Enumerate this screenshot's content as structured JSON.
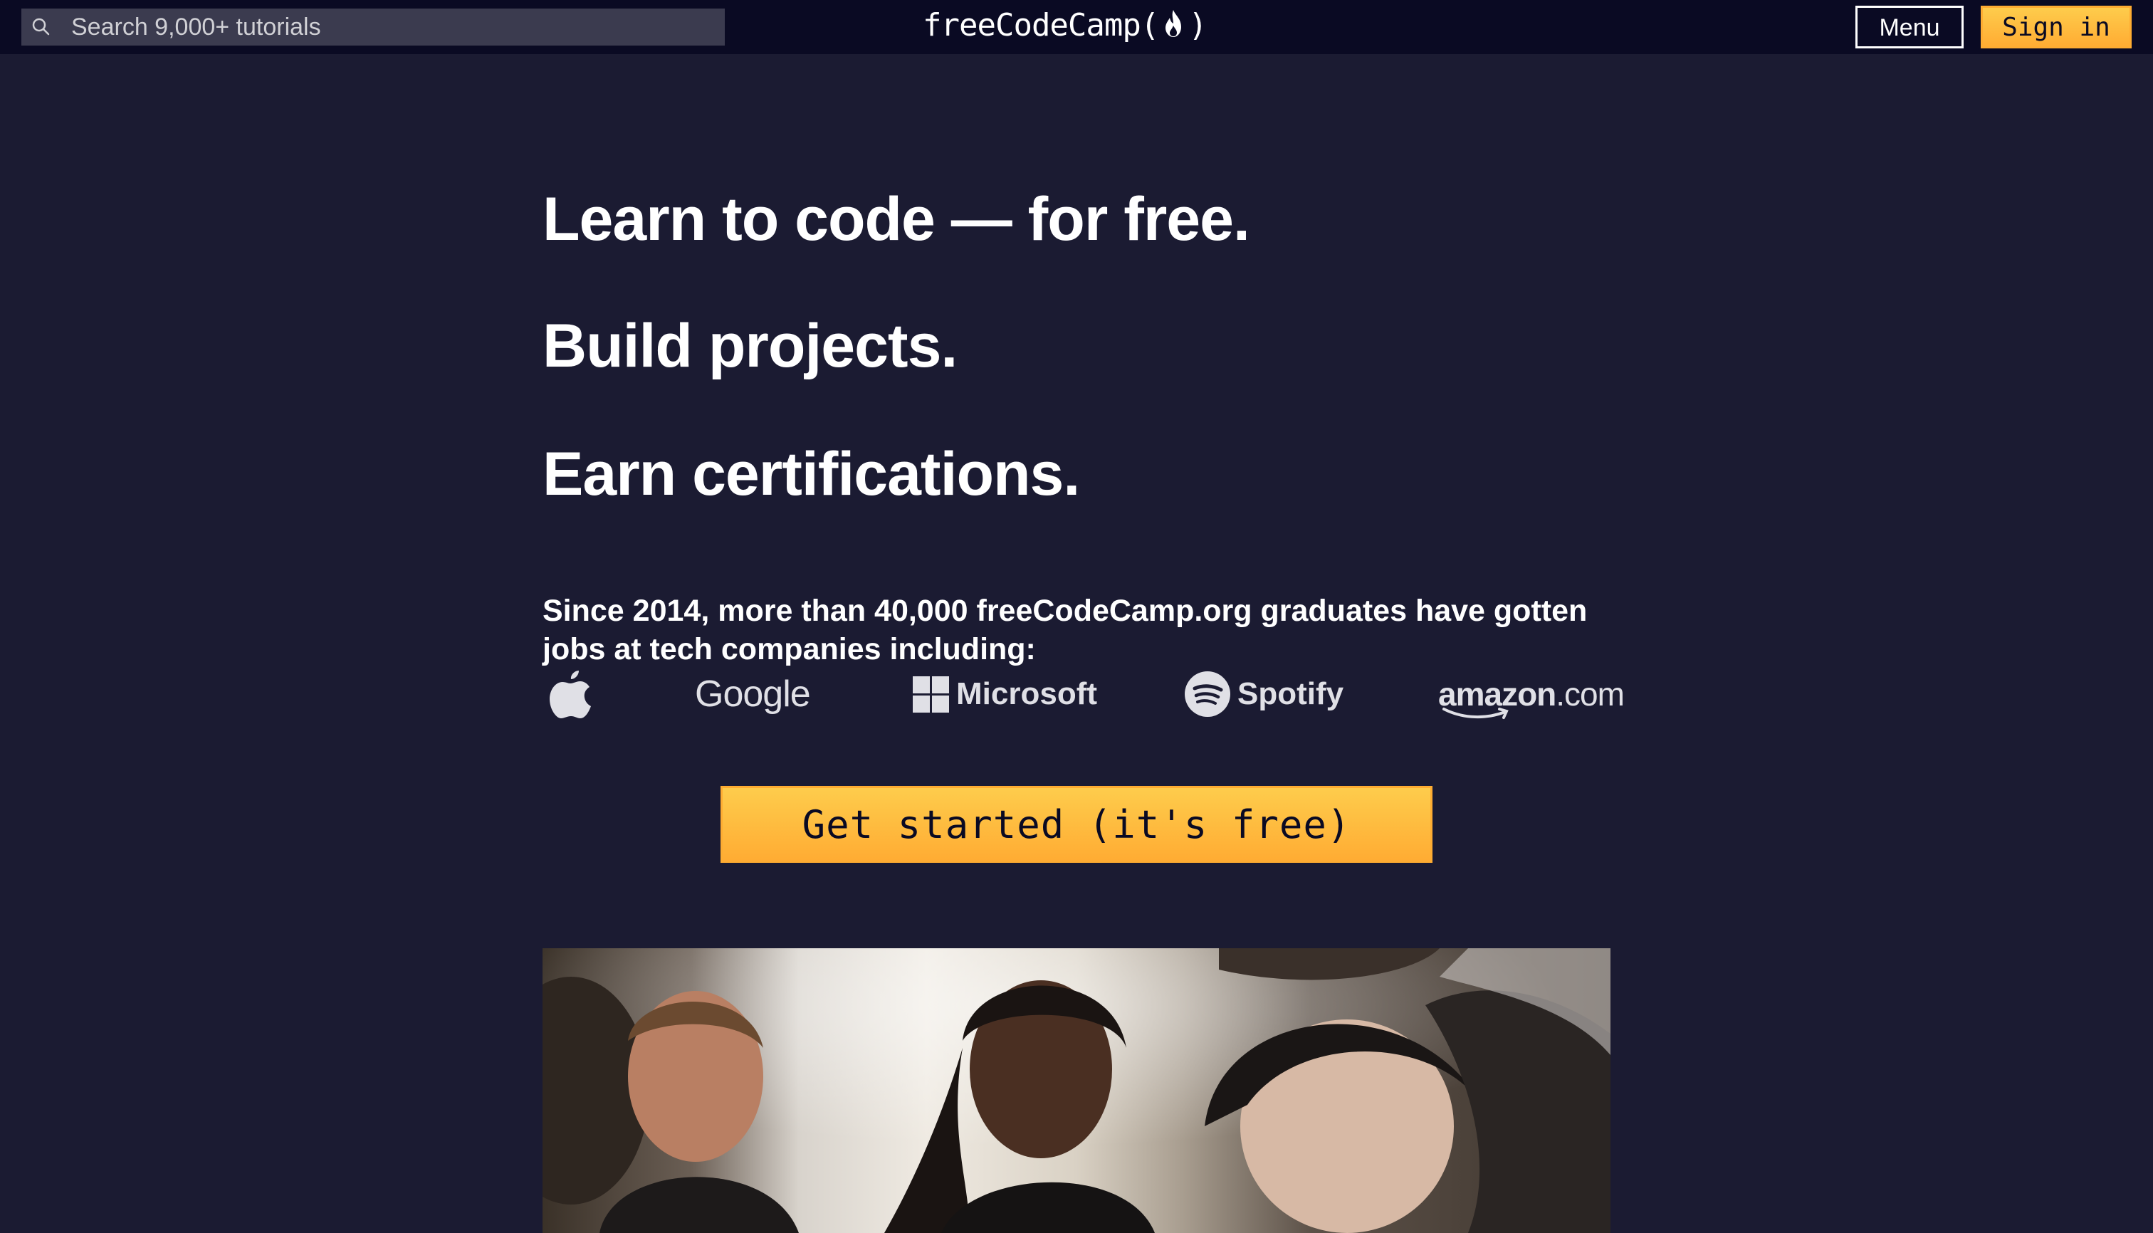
{
  "navbar": {
    "search_placeholder": "Search 9,000+ tutorials",
    "brand_left": "freeCodeCamp(",
    "brand_right": ")",
    "menu_label": "Menu",
    "signin_label": "Sign in"
  },
  "hero": {
    "line1": "Learn to code — for free.",
    "line2": "Build projects.",
    "line3": "Earn certifications.",
    "since_text": "Since 2014, more than 40,000 freeCodeCamp.org graduates have gotten jobs at tech companies including:"
  },
  "logos": {
    "google": "Google",
    "microsoft": "Microsoft",
    "spotify": "Spotify",
    "amazon": "amazon",
    "amazon_suffix": ".com"
  },
  "cta": {
    "label": "Get started (it's free)"
  },
  "colors": {
    "background": "#1b1b32",
    "navbar": "#0a0a23",
    "accent": "#feac32",
    "text": "#ffffff"
  },
  "icons": {
    "search": "search-icon",
    "flame": "flame-icon",
    "apple": "apple-logo-icon",
    "microsoft": "microsoft-logo-icon",
    "spotify": "spotify-logo-icon",
    "amazon": "amazon-smile-icon"
  }
}
